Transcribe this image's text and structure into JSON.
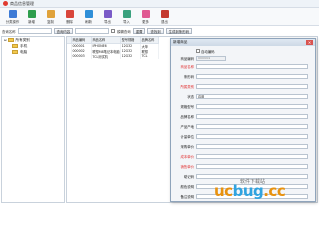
{
  "window": {
    "title": "商品信息管理"
  },
  "toolbar": {
    "items": [
      {
        "label": "分类操作",
        "icon": "category-icon",
        "color": "#3d7bd6"
      },
      {
        "label": "新增",
        "icon": "add-icon",
        "color": "#2e9e4d"
      },
      {
        "label": "复制",
        "icon": "copy-icon",
        "color": "#e0a23a"
      },
      {
        "label": "删除",
        "icon": "delete-icon",
        "color": "#d9463b"
      },
      {
        "label": "刷新",
        "icon": "refresh-icon",
        "color": "#2f8fd8"
      },
      {
        "label": "导出",
        "icon": "export-icon",
        "color": "#7a5bc7"
      },
      {
        "label": "导入",
        "icon": "import-icon",
        "color": "#3aa17e"
      },
      {
        "label": "更多",
        "icon": "more-icon",
        "color": "#e05a93"
      },
      {
        "label": "退出",
        "icon": "exit-icon",
        "color": "#c4392f"
      }
    ]
  },
  "search": {
    "label": "查询名称",
    "button": "查询内容",
    "checkbox_label": "模糊查询",
    "btn_reset": "重置",
    "btn_query": "查找到",
    "btn_generate": "生成到条形码"
  },
  "tree": {
    "root": "所有类别",
    "children": [
      "手机",
      "电脑"
    ]
  },
  "grid": {
    "columns": [
      "商品编码",
      "商品名称",
      "型号规格",
      "品牌名称"
    ],
    "rows": [
      [
        "000001",
        "IPHONE6",
        "12G32",
        "大苹"
      ],
      [
        "000002",
        "联想M8笔记本电脑",
        "12G32",
        "联想"
      ],
      [
        "000003",
        "TCL测试机",
        "12G32",
        "TCL"
      ]
    ]
  },
  "dialog": {
    "title": "新增商品",
    "auto_code_label": "自动编码",
    "code_label": "商品编码",
    "code_value": "000004",
    "fields": [
      {
        "label": "商品名称",
        "value": "",
        "required": true
      },
      {
        "label": "条形码",
        "value": "",
        "required": false
      },
      {
        "label": "所属类别",
        "value": "",
        "required": true
      },
      {
        "label": "状态",
        "value": "启用",
        "required": false
      },
      {
        "label": "规格型号",
        "value": "",
        "required": false
      },
      {
        "label": "品牌名称",
        "value": "",
        "required": false
      },
      {
        "label": "产品产地",
        "value": "",
        "required": false
      },
      {
        "label": "计量单位",
        "value": "",
        "required": false
      },
      {
        "label": "采购单价",
        "value": "",
        "required": false
      },
      {
        "label": "成本单价",
        "value": "",
        "required": true
      },
      {
        "label": "销售单价",
        "value": "",
        "required": true
      },
      {
        "label": "助记码",
        "value": "",
        "required": false
      },
      {
        "label": "颜色说明",
        "value": "",
        "required": false
      },
      {
        "label": "备注说明",
        "value": "",
        "required": false
      }
    ]
  },
  "watermark": {
    "big1": "uc",
    "big2": "bug",
    "big3": ".cc",
    "small": "软件下载站"
  }
}
